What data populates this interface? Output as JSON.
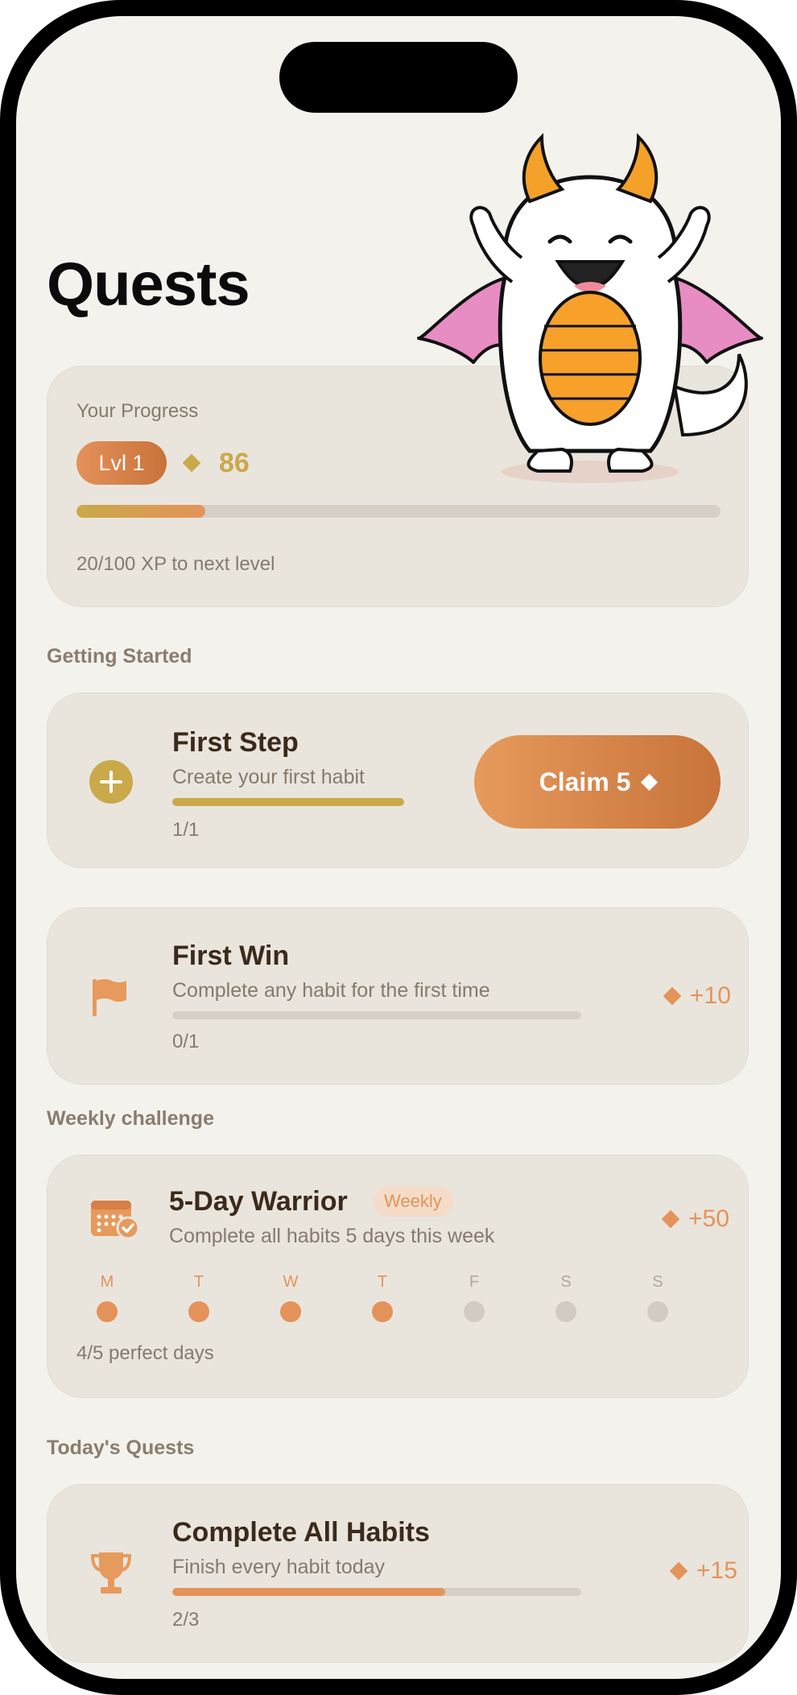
{
  "page": {
    "title": "Quests"
  },
  "progress": {
    "label": "Your Progress",
    "level_badge": "Lvl 1",
    "gems": "86",
    "xp_text": "20/100 XP to next level",
    "xp_fraction": 0.2
  },
  "sections": {
    "getting_started": "Getting Started",
    "weekly": "Weekly challenge",
    "today": "Today's Quests"
  },
  "quests": {
    "first_step": {
      "title": "First Step",
      "subtitle": "Create your first habit",
      "count": "1/1",
      "claim_label": "Claim 5",
      "progress": 1.0
    },
    "first_win": {
      "title": "First Win",
      "subtitle": "Complete any habit for the first time",
      "count": "0/1",
      "reward": "+10",
      "progress": 0.0
    },
    "weekly_warrior": {
      "title": "5-Day Warrior",
      "tag": "Weekly",
      "subtitle": "Complete all habits 5 days this week",
      "reward": "+50",
      "count": "4/5 perfect days",
      "days": [
        {
          "letter": "M",
          "done": true
        },
        {
          "letter": "T",
          "done": true
        },
        {
          "letter": "W",
          "done": true
        },
        {
          "letter": "T",
          "done": true
        },
        {
          "letter": "F",
          "done": false
        },
        {
          "letter": "S",
          "done": false
        },
        {
          "letter": "S",
          "done": false
        }
      ]
    },
    "complete_all": {
      "title": "Complete All Habits",
      "subtitle": "Finish every habit today",
      "count": "2/3",
      "reward": "+15",
      "progress": 0.667
    }
  },
  "colors": {
    "accent": "#e4935a",
    "gold": "#c9a94a",
    "text_dark": "#3b2a1a",
    "muted": "#857a6c",
    "card": "#e9e5dd",
    "bg": "#f4f2ed"
  },
  "icons": {
    "mascot": "dragon-mascot",
    "first_step": "plus-circle-icon",
    "first_win": "flag-icon",
    "weekly": "calendar-check-icon",
    "complete_all": "trophy-icon"
  }
}
